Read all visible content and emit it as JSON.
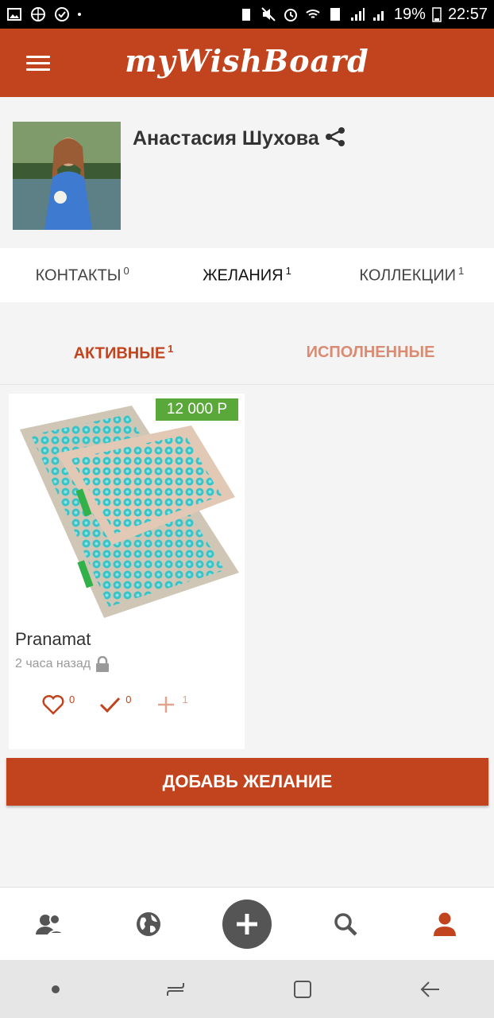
{
  "status_bar": {
    "battery": "19%",
    "time": "22:57"
  },
  "app_bar": {
    "title": "myWishBoard"
  },
  "profile": {
    "name": "Анастасия Шухова"
  },
  "tabs": [
    {
      "label": "КОНТАКТЫ",
      "count": "0"
    },
    {
      "label": "ЖЕЛАНИЯ",
      "count": "1"
    },
    {
      "label": "КОЛЛЕКЦИИ",
      "count": "1"
    }
  ],
  "subtabs": [
    {
      "label": "АКТИВНЫЕ",
      "count": "1"
    },
    {
      "label": "ИСПОЛНЕННЫЕ",
      "count": ""
    }
  ],
  "wish": {
    "price": "12 000 Р",
    "title": "Pranamat",
    "time": "2 часа назад",
    "likes": "0",
    "done": "0",
    "adds": "1"
  },
  "add_button": "ДОБАВЬ ЖЕЛАНИЕ",
  "bottom_nav": [
    "friends-icon",
    "globe-icon",
    "plus-icon",
    "search-icon",
    "profile-icon"
  ],
  "colors": {
    "brand": "#c1441f",
    "price_badge": "#5aa83a",
    "mat": "#dcd3c4",
    "spikes": "#38c3c6"
  }
}
